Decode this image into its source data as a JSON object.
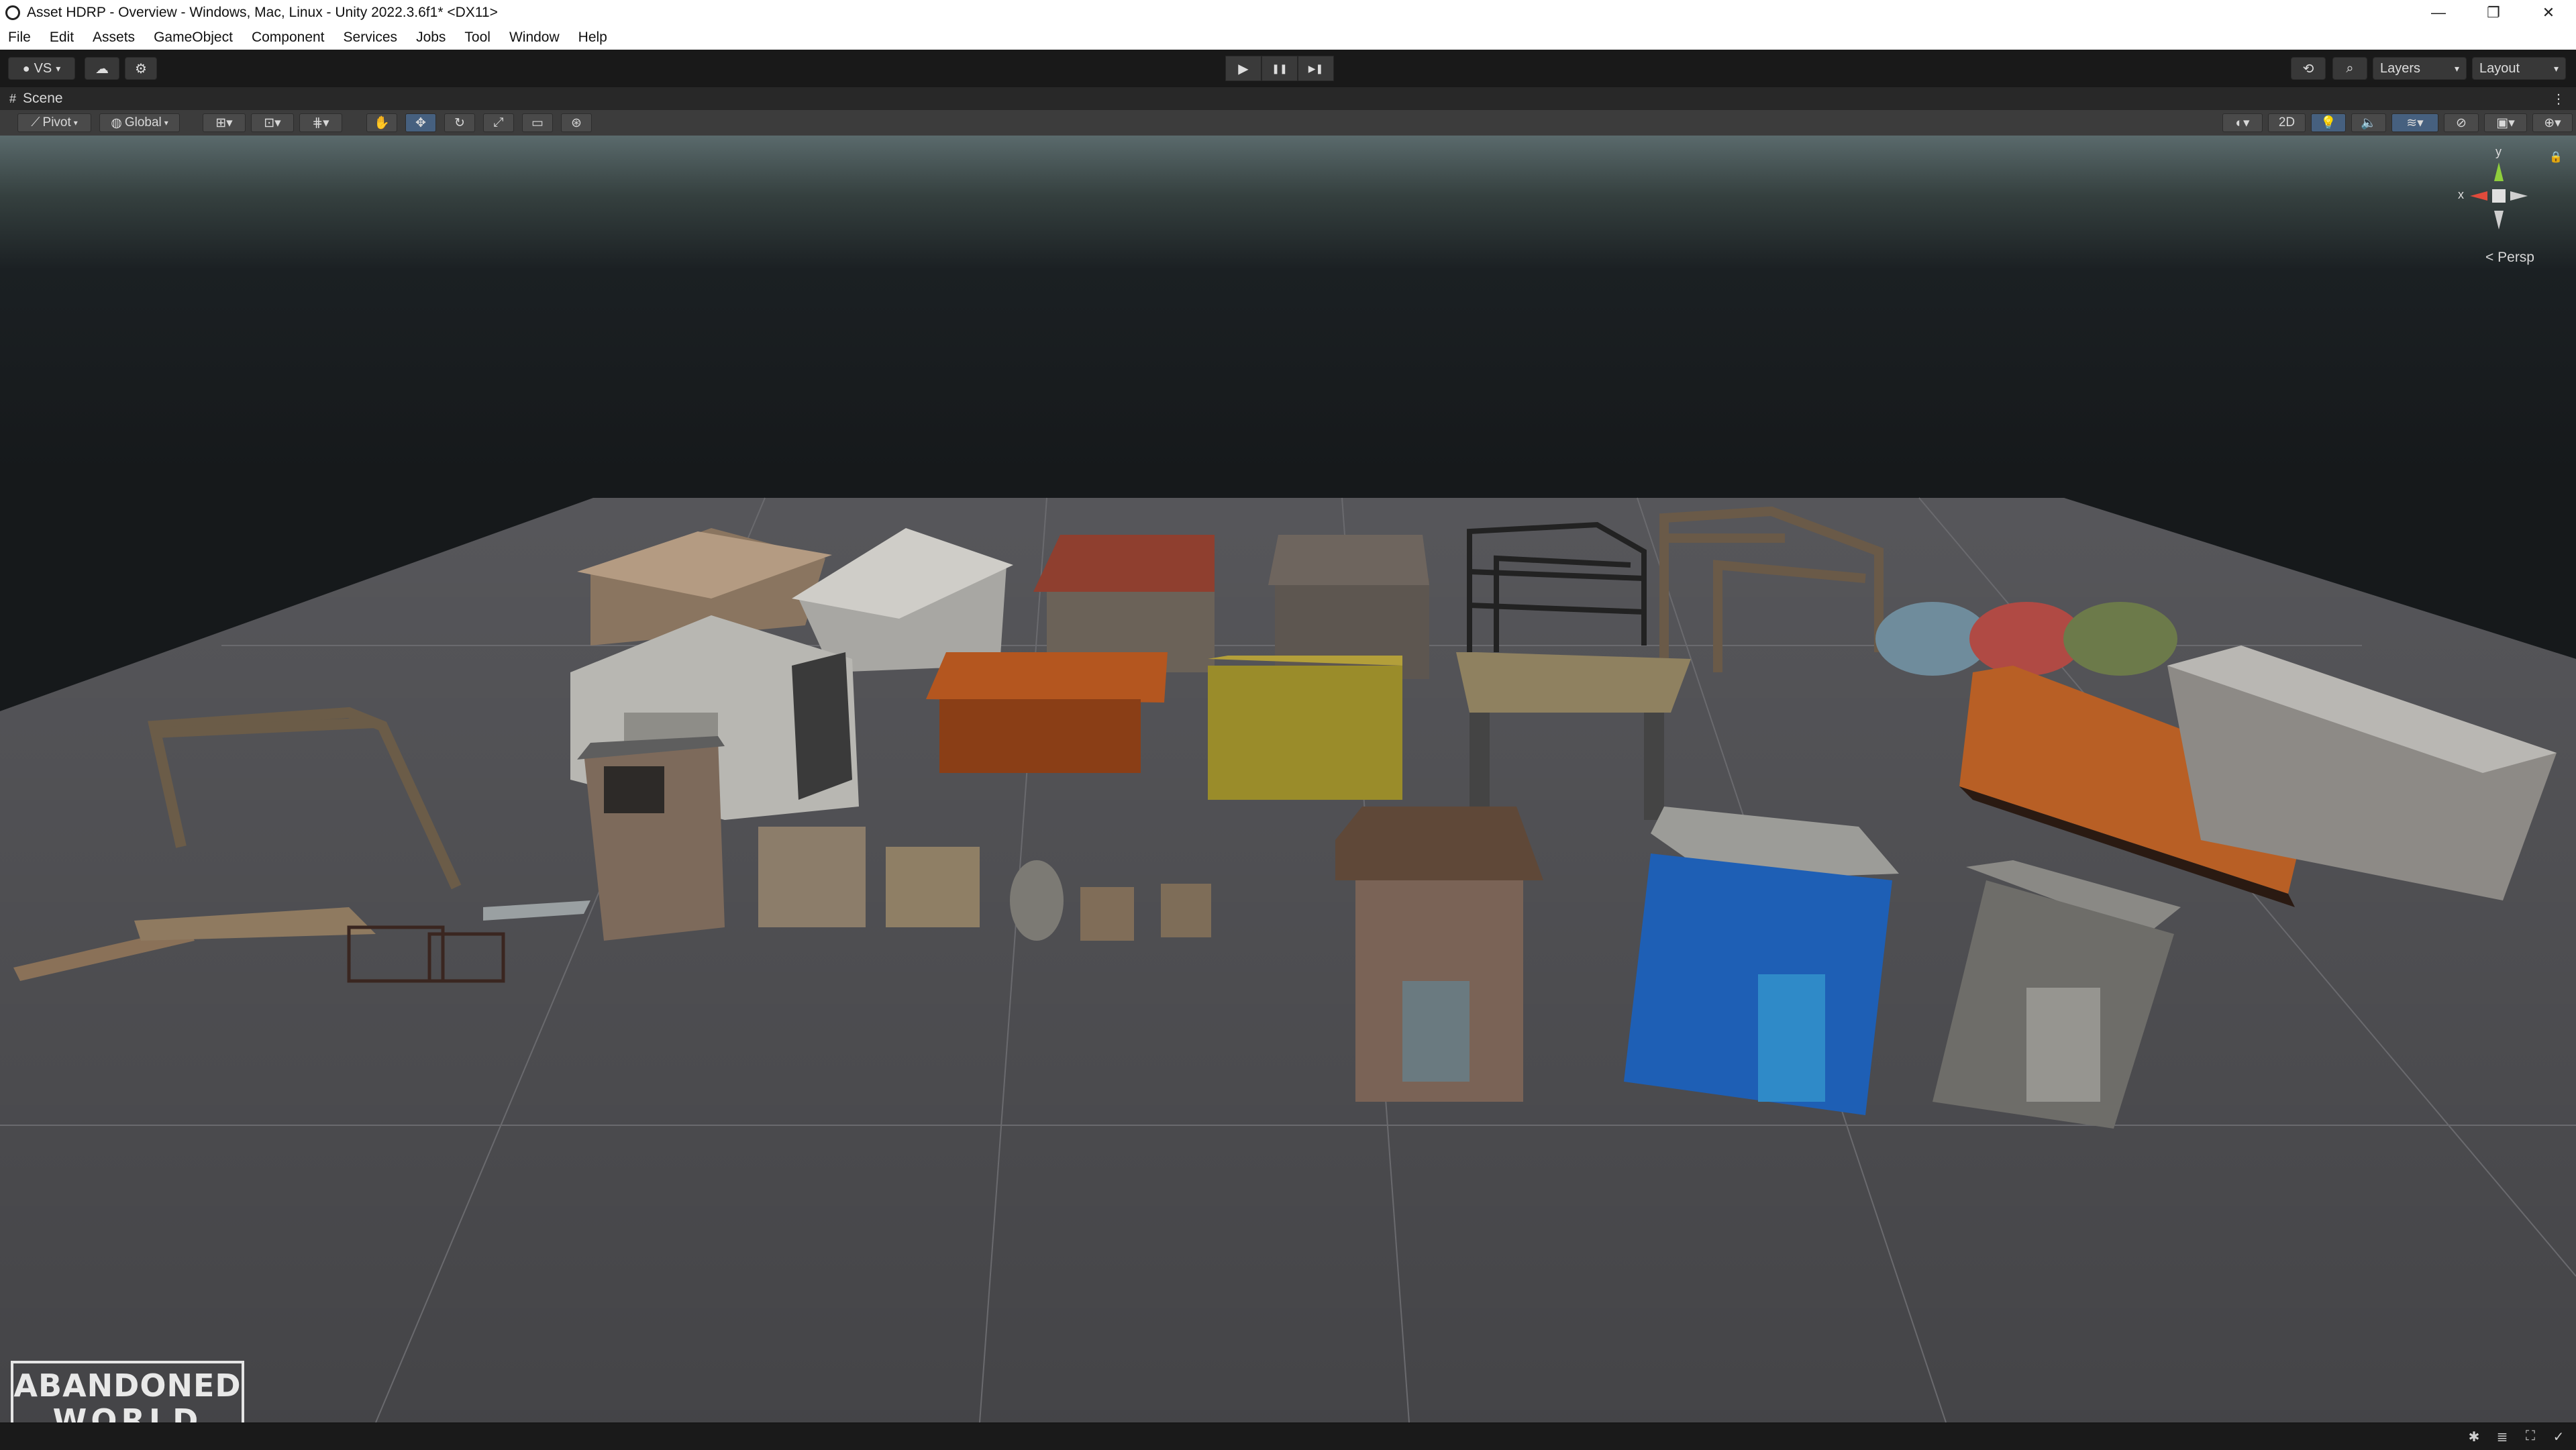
{
  "window": {
    "title": "Asset HDRP - Overview - Windows, Mac, Linux - Unity 2022.3.6f1* <DX11>",
    "controls": [
      "—",
      "❐",
      "✕"
    ]
  },
  "menu": [
    "File",
    "Edit",
    "Assets",
    "GameObject",
    "Component",
    "Services",
    "Jobs",
    "Tool",
    "Window",
    "Help"
  ],
  "toolbar": {
    "account_label": "VS",
    "play_icons": [
      "▶",
      "❚❚",
      "▶❚"
    ],
    "layers_label": "Layers",
    "layout_label": "Layout"
  },
  "scene_tab": {
    "label": "Scene"
  },
  "scene_toolbar": {
    "pivot_label": "Pivot",
    "global_label": "Global",
    "twod_label": "2D"
  },
  "gizmo": {
    "y_label": "y",
    "x_label": "x",
    "projection_label": "< Persp"
  },
  "logo": {
    "line1": "ABANDONED",
    "line2": "WORLD"
  },
  "colors": {
    "editor_bg": "#1f1f1f",
    "toolbar_bg": "#191919",
    "scene_toolbar_bg": "#3c3c3c",
    "active_accent": "#46607f",
    "ground_plane": "#5a5a5e",
    "container_orange": "#c46a2a",
    "booth_blue": "#1e5fb5"
  }
}
